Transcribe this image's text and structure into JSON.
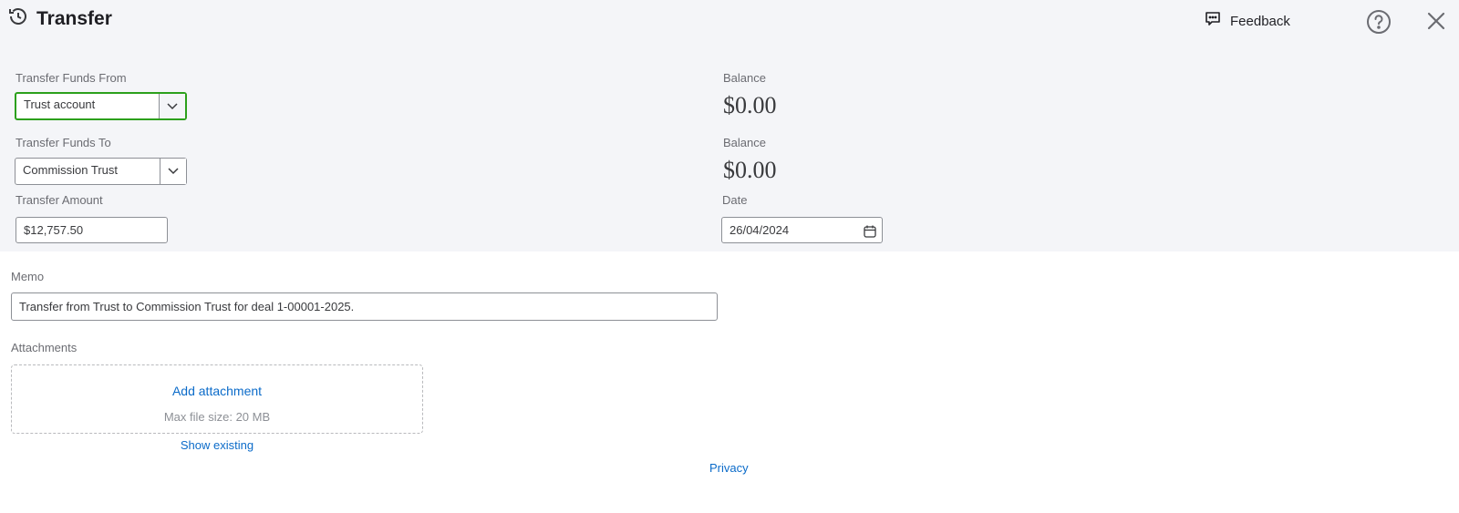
{
  "header": {
    "title": "Transfer",
    "feedback_label": "Feedback"
  },
  "form": {
    "from": {
      "label": "Transfer Funds From",
      "value": "Trust account",
      "balance_label": "Balance",
      "balance": "$0.00"
    },
    "to": {
      "label": "Transfer Funds To",
      "value": "Commission Trust",
      "balance_label": "Balance",
      "balance": "$0.00"
    },
    "amount": {
      "label": "Transfer Amount",
      "value": "$12,757.50"
    },
    "date": {
      "label": "Date",
      "value": "26/04/2024"
    },
    "memo": {
      "label": "Memo",
      "value": "Transfer from Trust to Commission Trust for deal 1-00001-2025."
    }
  },
  "attachments": {
    "label": "Attachments",
    "add_label": "Add attachment",
    "max_size": "Max file size: 20 MB",
    "show_existing": "Show existing"
  },
  "footer": {
    "privacy": "Privacy"
  },
  "colors": {
    "accent_green": "#2ca01c",
    "link_blue": "#0b6bc9",
    "header_bg": "#f4f5f8"
  }
}
